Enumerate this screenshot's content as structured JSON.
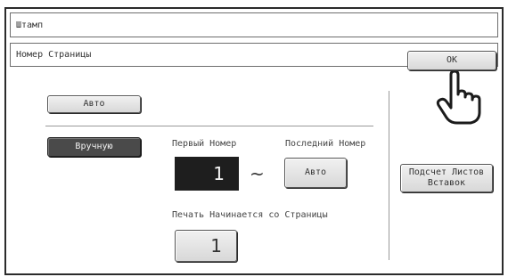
{
  "window": {
    "title": "Штамп",
    "subtitle": "Номер Страницы"
  },
  "ok_button": {
    "label": "OK"
  },
  "mode": {
    "auto_label": "Авто",
    "manual_label": "Вручную",
    "selected": "manual"
  },
  "numbering": {
    "first_label": "Первый Номер",
    "first_value": "1",
    "separator": "~",
    "last_label": "Последний Номер",
    "last_button": "Авто"
  },
  "start_page": {
    "label": "Печать Начинается со Страницы",
    "value": "1"
  },
  "count_button": {
    "label": "Подсчет Листов Вставок"
  },
  "icons": {
    "pointer": "pointing-hand-icon"
  }
}
